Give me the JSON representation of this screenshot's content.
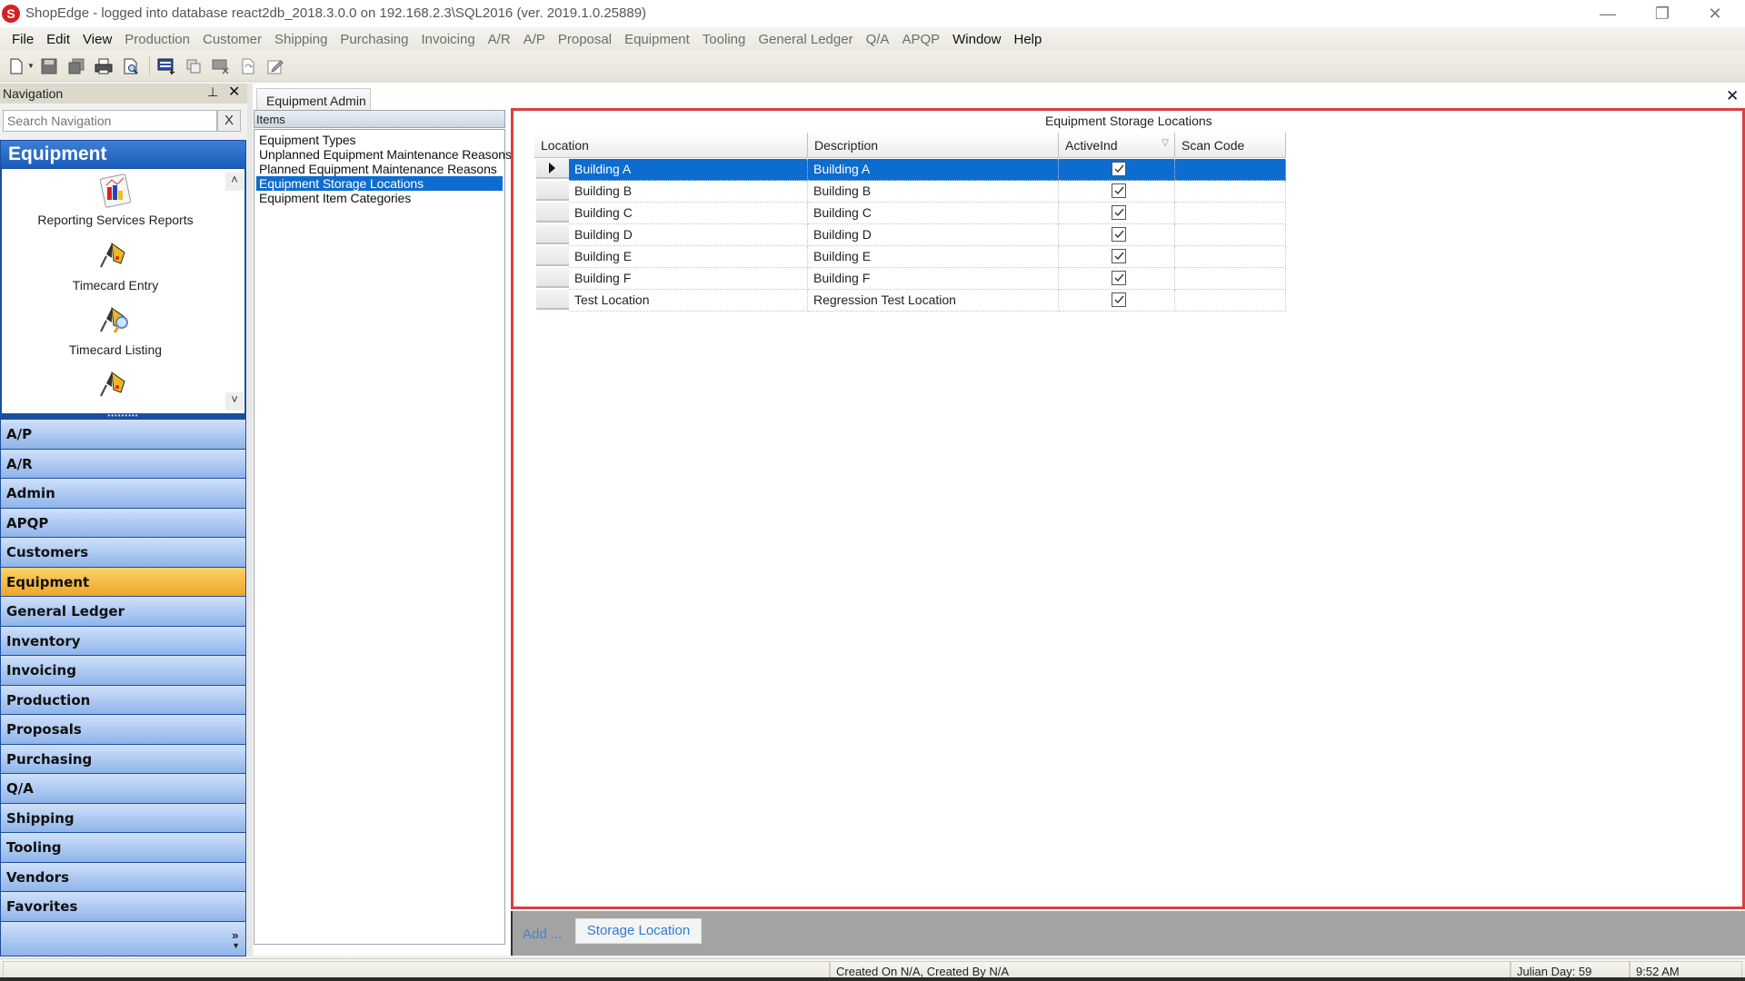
{
  "window": {
    "logo_glyph": "S",
    "title": "ShopEdge -  logged into database react2db_2018.3.0.0 on 192.168.2.3\\SQL2016 (ver. 2019.1.0.25889)",
    "controls": {
      "minimize": "—",
      "restore": "❐",
      "close": "✕"
    }
  },
  "menu": [
    {
      "label": "File",
      "enabled": true
    },
    {
      "label": "Edit",
      "enabled": true
    },
    {
      "label": "View",
      "enabled": true
    },
    {
      "label": "Production",
      "enabled": false
    },
    {
      "label": "Customer",
      "enabled": false
    },
    {
      "label": "Shipping",
      "enabled": false
    },
    {
      "label": "Purchasing",
      "enabled": false
    },
    {
      "label": "Invoicing",
      "enabled": false
    },
    {
      "label": "A/R",
      "enabled": false
    },
    {
      "label": "A/P",
      "enabled": false
    },
    {
      "label": "Proposal",
      "enabled": false
    },
    {
      "label": "Equipment",
      "enabled": false
    },
    {
      "label": "Tooling",
      "enabled": false
    },
    {
      "label": "General Ledger",
      "enabled": false
    },
    {
      "label": "Q/A",
      "enabled": false
    },
    {
      "label": "APQP",
      "enabled": false
    },
    {
      "label": "Window",
      "enabled": true
    },
    {
      "label": "Help",
      "enabled": true
    }
  ],
  "toolbar": {
    "icons": [
      "new-document-icon",
      "save-icon",
      "save-all-icon",
      "print-icon",
      "print-preview-icon",
      "add-record-icon",
      "copy-record-icon",
      "delete-record-icon",
      "refresh-icon",
      "edit-icon"
    ]
  },
  "navigation": {
    "title": "Navigation",
    "pin_glyph": "⊥",
    "close_glyph": "✕",
    "search": {
      "placeholder": "Search Navigation",
      "value": "",
      "clear_label": "X"
    },
    "current_group": "Equipment",
    "shortcuts": [
      {
        "label": "Reporting Services Reports",
        "icon": "report-chart-icon"
      },
      {
        "label": "Timecard Entry",
        "icon": "drill-icon"
      },
      {
        "label": "Timecard Listing",
        "icon": "drill-search-icon"
      },
      {
        "label": "",
        "icon": "drill-icon"
      }
    ],
    "scroll_up": "˄",
    "scroll_down": "˅",
    "splitter_glyph": "•••••••••",
    "groups": [
      "A/P",
      "A/R",
      "Admin",
      "APQP",
      "Customers",
      "Equipment",
      "General Ledger",
      "Inventory",
      "Invoicing",
      "Production",
      "Proposals",
      "Purchasing",
      "Q/A",
      "Shipping",
      "Tooling",
      "Vendors",
      "Favorites"
    ],
    "selected_group": "Equipment",
    "overflow_glyph": "»"
  },
  "document": {
    "tab_label": "Equipment Admin",
    "close_glyph": "✕",
    "items_header": "Items",
    "items": [
      {
        "label": "Equipment Types",
        "selected": false
      },
      {
        "label": "Unplanned Equipment Maintenance Reasons",
        "selected": false
      },
      {
        "label": "Planned Equipment Maintenance Reasons",
        "selected": false
      },
      {
        "label": "Equipment Storage Locations",
        "selected": true
      },
      {
        "label": "Equipment Item Categories",
        "selected": false
      }
    ],
    "grid": {
      "title": "Equipment Storage Locations",
      "columns": [
        "Location",
        "Description",
        "ActiveInd",
        "Scan Code"
      ],
      "filter_glyph": "▽",
      "rows": [
        {
          "location": "Building A",
          "description": "Building A",
          "active": true,
          "scan_code": "",
          "selected": true
        },
        {
          "location": "Building B",
          "description": "Building B",
          "active": true,
          "scan_code": "",
          "selected": false
        },
        {
          "location": "Building C",
          "description": "Building C",
          "active": true,
          "scan_code": "",
          "selected": false
        },
        {
          "location": "Building D",
          "description": "Building D",
          "active": true,
          "scan_code": "",
          "selected": false
        },
        {
          "location": "Building E",
          "description": "Building E",
          "active": true,
          "scan_code": "",
          "selected": false
        },
        {
          "location": "Building F",
          "description": "Building F",
          "active": true,
          "scan_code": "",
          "selected": false
        },
        {
          "location": "Test Location",
          "description": "Regression Test Location",
          "active": true,
          "scan_code": "",
          "selected": false
        }
      ]
    },
    "commands": {
      "add_label": "Add ...",
      "storage_location_button": "Storage Location"
    }
  },
  "status": {
    "created": "Created On N/A, Created By N/A",
    "julian_day": "Julian Day: 59",
    "time": "9:52 AM"
  },
  "colors": {
    "selection_blue": "#0c6ccf",
    "nav_group_blue": "#8fb4ea",
    "nav_selected_orange": "#eda62a",
    "panel_border_red": "#d94040",
    "link_blue": "#2f7ad0"
  }
}
